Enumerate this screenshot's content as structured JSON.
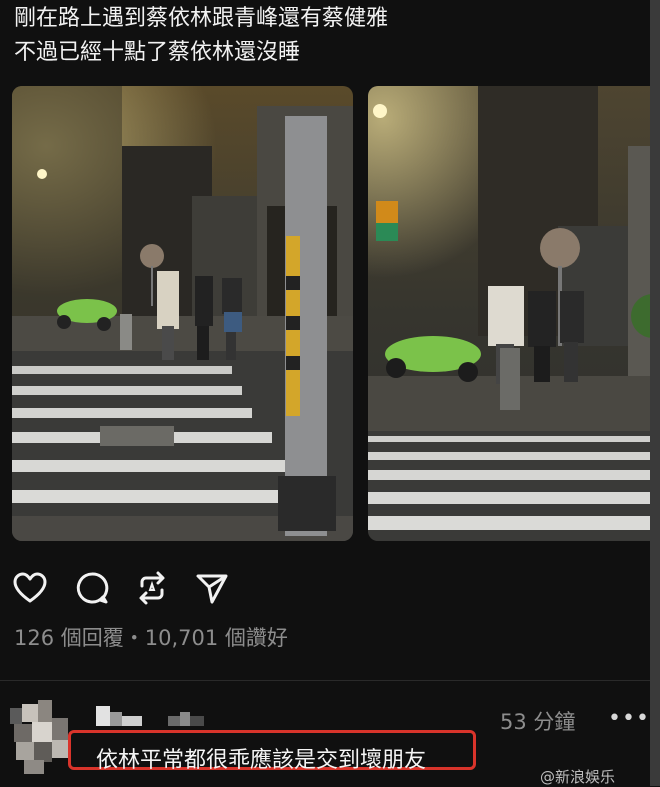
{
  "post": {
    "text_line1": "剛在路上遇到蔡依林跟青峰還有蔡健雅",
    "text_line2": "不過已經十點了蔡依林還沒睡"
  },
  "photos": [
    {
      "name": "street-photo-1"
    },
    {
      "name": "street-photo-2"
    }
  ],
  "actions": [
    "heart-icon",
    "comment-icon",
    "repost-icon",
    "share-icon"
  ],
  "stats": {
    "text": "126 個回覆・10,701 個讚好"
  },
  "reply": {
    "time": "53 分鐘",
    "more": "•••",
    "text": "依林平常都很乖應該是交到壞朋友"
  },
  "watermark": "@新浪娛乐",
  "colors": {
    "background": "#101010",
    "highlight_border": "#d9342b",
    "muted_text": "#8d8d8d"
  }
}
